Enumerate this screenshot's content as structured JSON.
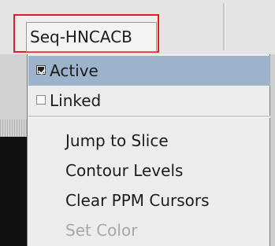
{
  "toolbar": {
    "spectrum_tab_label": "Seq-HNCACB"
  },
  "context_menu": {
    "items": [
      {
        "label": "Active",
        "type": "checkbox",
        "checked": true,
        "highlighted": true,
        "enabled": true
      },
      {
        "label": "Linked",
        "type": "checkbox",
        "checked": false,
        "highlighted": false,
        "enabled": true
      },
      {
        "label": "Jump to Slice",
        "type": "action",
        "enabled": true
      },
      {
        "label": "Contour Levels",
        "type": "action",
        "enabled": true
      },
      {
        "label": "Clear PPM Cursors",
        "type": "action",
        "enabled": true
      },
      {
        "label": "Set Color",
        "type": "action",
        "enabled": false
      }
    ]
  },
  "colors": {
    "highlight": "#9db3cc",
    "tab_outline": "#e02020",
    "disabled_text": "#a8a8a8"
  }
}
